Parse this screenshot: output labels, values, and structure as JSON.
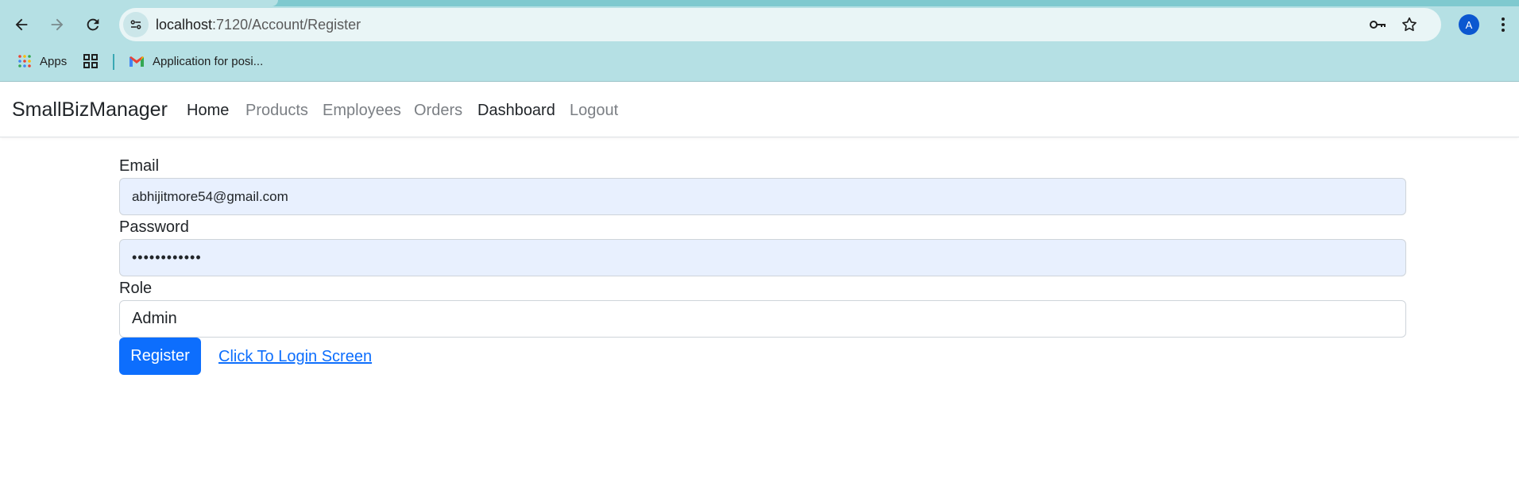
{
  "browser": {
    "url_host": "localhost",
    "url_path": ":7120/Account/Register",
    "profile_initial": "A",
    "bookmarks": {
      "apps_label": "Apps",
      "gmail_label": "Application for posi..."
    },
    "icons": [
      "back-arrow-icon",
      "forward-arrow-icon",
      "reload-icon",
      "site-info-icon",
      "password-key-icon",
      "star-bookmark-icon",
      "menu-dots-icon",
      "apps-grid-icon",
      "tab-groups-icon",
      "gmail-icon"
    ]
  },
  "navbar": {
    "brand": "SmallBizManager",
    "links": {
      "home": "Home",
      "products": "Products",
      "employees": "Employees",
      "orders": "Orders",
      "dashboard": "Dashboard",
      "logout": "Logout"
    }
  },
  "form": {
    "email_label": "Email",
    "email_value": "abhijitmore54@gmail.com",
    "password_label": "Password",
    "password_value": "••••••••••••",
    "role_label": "Role",
    "role_value": "Admin",
    "register_button": "Register",
    "login_link": "Click To Login Screen"
  },
  "colors": {
    "chrome_bg": "#b5e0e4",
    "primary": "#0d6efd",
    "autofill_bg": "#e8f0fe"
  }
}
